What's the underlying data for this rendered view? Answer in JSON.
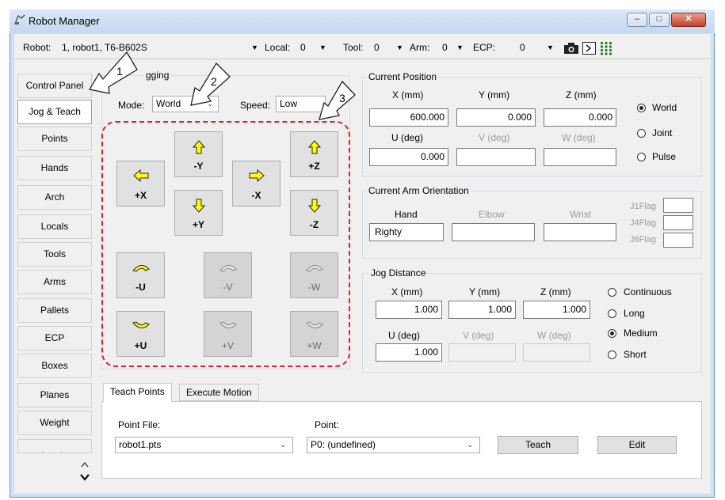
{
  "window": {
    "title": "Robot Manager"
  },
  "toolbar": {
    "robot_label": "Robot:",
    "robot_value": "1, robot1, T6-B602S",
    "local_label": "Local:",
    "local_value": "0",
    "tool_label": "Tool:",
    "tool_value": "0",
    "arm_label": "Arm:",
    "arm_value": "0",
    "ecp_label": "ECP:",
    "ecp_value": "0"
  },
  "sidebar": {
    "items": [
      {
        "label": "Control Panel"
      },
      {
        "label": "Jog & Teach"
      },
      {
        "label": "Points"
      },
      {
        "label": "Hands"
      },
      {
        "label": "Arch"
      },
      {
        "label": "Locals"
      },
      {
        "label": "Tools"
      },
      {
        "label": "Arms"
      },
      {
        "label": "Pallets"
      },
      {
        "label": "ECP"
      },
      {
        "label": "Boxes"
      },
      {
        "label": "Planes"
      },
      {
        "label": "Weight"
      },
      {
        "label": "Inertia"
      }
    ]
  },
  "jogging": {
    "title": "Jogging",
    "title_visible": "gging",
    "mode_label": "Mode:",
    "mode_value": "World",
    "speed_label": "Speed:",
    "speed_value": "Low",
    "buttons": {
      "neg_y": "-Y",
      "pos_z": "+Z",
      "pos_x": "+X",
      "neg_x": "-X",
      "pos_y": "+Y",
      "neg_z": "-Z",
      "neg_u": "-U",
      "neg_v": "-V",
      "neg_w": "-W",
      "pos_u": "+U",
      "pos_v": "+V",
      "pos_w": "+W"
    }
  },
  "current_position": {
    "title": "Current Position",
    "x_label": "X (mm)",
    "y_label": "Y (mm)",
    "z_label": "Z (mm)",
    "x_value": "600.000",
    "y_value": "0.000",
    "z_value": "0.000",
    "u_label": "U (deg)",
    "v_label": "V (deg)",
    "w_label": "W (deg)",
    "u_value": "0.000",
    "v_value": "",
    "w_value": "",
    "radios": [
      {
        "label": "World",
        "selected": true
      },
      {
        "label": "Joint",
        "selected": false
      },
      {
        "label": "Pulse",
        "selected": false
      }
    ]
  },
  "arm_orientation": {
    "title": "Current Arm Orientation",
    "hand_label": "Hand",
    "elbow_label": "Elbow",
    "wrist_label": "Wrist",
    "hand_value": "Righty",
    "elbow_value": "",
    "wrist_value": "",
    "j1flag_label": "J1Flag",
    "j4flag_label": "J4Flag",
    "j6flag_label": "J6Flag"
  },
  "jog_distance": {
    "title": "Jog Distance",
    "x_label": "X (mm)",
    "y_label": "Y (mm)",
    "z_label": "Z (mm)",
    "x_value": "1.000",
    "y_value": "1.000",
    "z_value": "1.000",
    "u_label": "U (deg)",
    "v_label": "V (deg)",
    "w_label": "W (deg)",
    "u_value": "1.000",
    "radios": [
      {
        "label": "Continuous",
        "selected": false
      },
      {
        "label": "Long",
        "selected": false
      },
      {
        "label": "Medium",
        "selected": true
      },
      {
        "label": "Short",
        "selected": false
      }
    ]
  },
  "tabs": {
    "teach_points": "Teach Points",
    "execute_motion": "Execute Motion",
    "point_file_label": "Point File:",
    "point_file_value": "robot1.pts",
    "point_label": "Point:",
    "point_value": "P0: (undefined)",
    "teach_button": "Teach",
    "edit_button": "Edit"
  },
  "annotations": {
    "one": "1",
    "two": "2",
    "three": "3"
  },
  "colors": {
    "accent_yellow": "#ffff00",
    "annotation_red": "#e02020",
    "title_bar": "#cfe0f5"
  }
}
